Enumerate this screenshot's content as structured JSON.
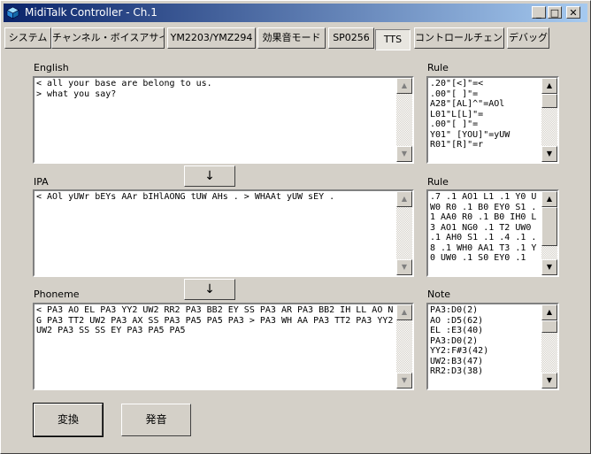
{
  "window": {
    "title": "MidiTalk Controller - Ch.1"
  },
  "titlebar_buttons": {
    "minimize": "_",
    "maximize": "□",
    "close": "✕"
  },
  "tabs": [
    {
      "label": "システム"
    },
    {
      "label": "チャンネル・ボイスアサイン"
    },
    {
      "label": "YM2203/YMZ294"
    },
    {
      "label": "効果音モード"
    },
    {
      "label": "SP0256"
    },
    {
      "label": "TTS"
    },
    {
      "label": "コントロールチェンジ"
    },
    {
      "label": "デバッグ"
    }
  ],
  "active_tab": "TTS",
  "english": {
    "label": "English",
    "text": "< all your base are belong to us.\n> what you say?"
  },
  "ipa": {
    "label": "IPA",
    "text": "< AOl yUWr bEYs AAr bIHlAONG tUW AHs . > WHAAt yUW sEY ."
  },
  "phoneme": {
    "label": "Phoneme",
    "text": "< PA3 AO EL PA3 YY2 UW2 RR2 PA3 BB2 EY SS PA3 AR PA3 BB2 IH LL AO NG PA3 TT2 UW2 PA3 AX SS PA3 PA5 PA5 PA3 > PA3 WH AA PA3 TT2 PA3 YY2 UW2 PA3 SS SS EY PA3 PA5 PA5"
  },
  "arrow_buttons": {
    "to_ipa": "↓",
    "to_phoneme": "↓"
  },
  "rule1": {
    "label": "Rule",
    "text": ".20\"[<]\"=<\n.00\"[ ]\"=\nA28\"[AL]^\"=AOl\nL01\"L[L]\"=\n.00\"[ ]\"=\nY01\" [YOU]\"=yUW\nR01\"[R]\"=r"
  },
  "rule2": {
    "label": "Rule",
    "text": ".7 .1 AO1 L1 .1 Y0 UW0 R0 .1 B0 EY0 S1 .1 AA0 R0 .1 B0 IH0 L3 AO1 NG0 .1 T2 UW0 .1 AH0 S1 .1 .4 .1 .8 .1 WH0 AA1 T3 .1 Y0 UW0 .1 S0 EY0 .1"
  },
  "note": {
    "label": "Note",
    "text": "PA3:D0(2)\nAO :D5(62)\nEL :E3(40)\nPA3:D0(2)\nYY2:F#3(42)\nUW2:B3(47)\nRR2:D3(38)"
  },
  "buttons": {
    "convert": "変換",
    "speak": "発音"
  },
  "scroll": {
    "up": "▲",
    "down": "▼"
  },
  "colors": {
    "titlebar_start": "#0a246a",
    "titlebar_end": "#a6caf0",
    "face": "#d4d0c8"
  }
}
